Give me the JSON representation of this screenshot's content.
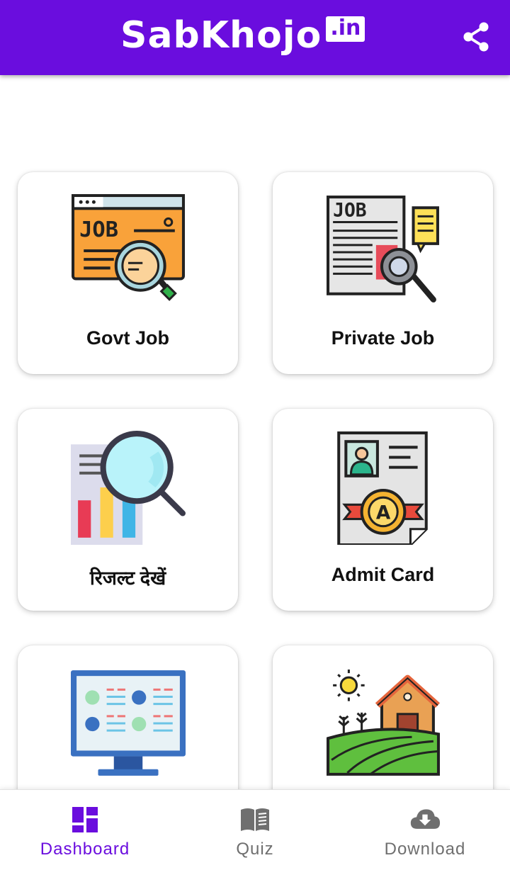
{
  "app": {
    "logo_text": "SabKhojo",
    "logo_tld": ".in",
    "share_icon": "share-icon",
    "brand_color": "#6a0dde"
  },
  "cards": [
    {
      "label": "Govt Job",
      "icon": "job-search-icon"
    },
    {
      "label": "Private Job",
      "icon": "job-newspaper-icon"
    },
    {
      "label": "रिजल्ट देखें",
      "icon": "result-chart-search-icon"
    },
    {
      "label": "Admit Card",
      "icon": "admit-card-icon"
    },
    {
      "label": "",
      "icon": "computer-monitor-icon"
    },
    {
      "label": "",
      "icon": "farm-house-icon"
    }
  ],
  "bottom_nav": {
    "items": [
      {
        "label": "Dashboard",
        "icon": "dashboard-icon",
        "active": true
      },
      {
        "label": "Quiz",
        "icon": "book-icon",
        "active": false
      },
      {
        "label": "Download",
        "icon": "cloud-download-icon",
        "active": false
      }
    ]
  }
}
